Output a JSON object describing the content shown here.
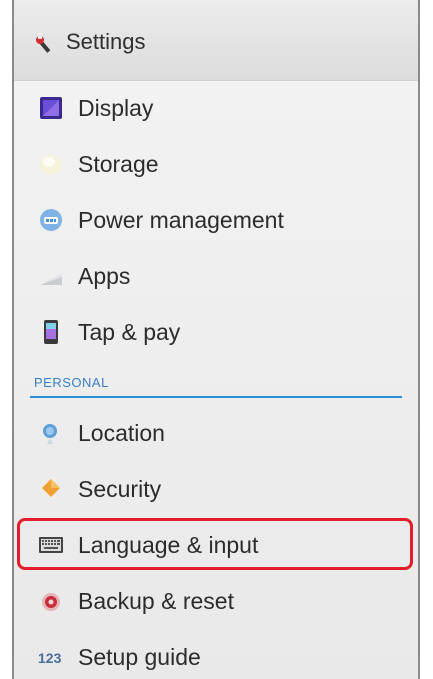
{
  "header": {
    "title": "Settings",
    "icon": "settings-wrench-icon"
  },
  "device_items": [
    {
      "label": "Display",
      "icon": "display-icon"
    },
    {
      "label": "Storage",
      "icon": "storage-icon"
    },
    {
      "label": "Power management",
      "icon": "power-management-icon"
    },
    {
      "label": "Apps",
      "icon": "apps-icon"
    },
    {
      "label": "Tap & pay",
      "icon": "tap-pay-icon"
    }
  ],
  "section_personal": "PERSONAL",
  "personal_items": [
    {
      "label": "Location",
      "icon": "location-icon"
    },
    {
      "label": "Security",
      "icon": "security-icon"
    },
    {
      "label": "Language & input",
      "icon": "keyboard-icon",
      "highlighted": true
    },
    {
      "label": "Backup & reset",
      "icon": "backup-reset-icon"
    },
    {
      "label": "Setup guide",
      "icon": "setup-guide-icon"
    }
  ],
  "colors": {
    "section_accent": "#2f8fd6",
    "highlight": "#e11e2a"
  }
}
